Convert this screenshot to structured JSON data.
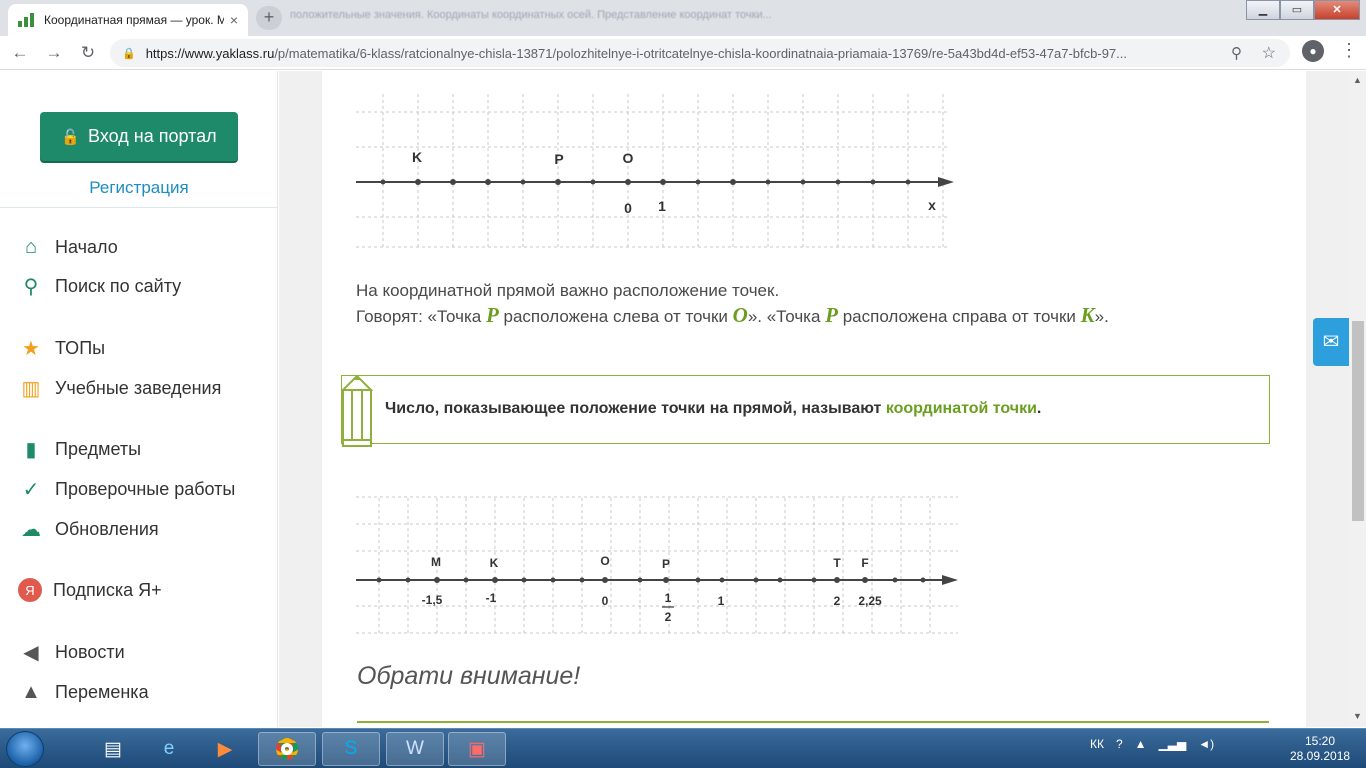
{
  "browser": {
    "tab_title": "Координатная прямая — урок. М",
    "tab_close": "×",
    "new_tab": "+",
    "blurred_tabs": "положительные значения. Координаты координатных осей. Представление координат точки...",
    "url_domain": "https://www.yaklass.ru",
    "url_path": "/p/matematika/6-klass/ratcionalnye-chisla-13871/polozhitelnye-i-otritcatelnye-chisla-koordinatnaia-priamaia-13769/re-5a43bd4d-ef53-47a7-bfcb-97...",
    "back": "←",
    "forward": "→",
    "reload": "↻",
    "zoom_icon": "⚲",
    "bookmark_icon": "☆",
    "menu_icon": "⋮",
    "minimize": "▁",
    "maximize": "▭",
    "close": "✕"
  },
  "sidebar": {
    "login_label": "Вход на портал",
    "register_label": "Регистрация",
    "items": [
      {
        "label": "Начало",
        "icon": "home-icon",
        "glyph": "⌂"
      },
      {
        "label": "Поиск по сайту",
        "icon": "search-icon",
        "glyph": "⚲"
      },
      {
        "label": "ТОПы",
        "icon": "star-icon",
        "glyph": "★"
      },
      {
        "label": "Учебные заведения",
        "icon": "institution-icon",
        "glyph": "▥"
      },
      {
        "label": "Предметы",
        "icon": "book-icon",
        "glyph": "▮"
      },
      {
        "label": "Проверочные работы",
        "icon": "check-circle-icon",
        "glyph": "✓"
      },
      {
        "label": "Обновления",
        "icon": "cloud-update-icon",
        "glyph": "☁"
      },
      {
        "label": "Подписка Я+",
        "icon": "subscription-icon",
        "glyph": "Я"
      },
      {
        "label": "Новости",
        "icon": "megaphone-icon",
        "glyph": "◀"
      },
      {
        "label": "Переменка",
        "icon": "bell-icon",
        "glyph": "▲"
      }
    ],
    "accent": "#1f8a6a"
  },
  "lesson": {
    "line1": {
      "point_labels": [
        "K",
        "P",
        "O"
      ],
      "tick_labels": [
        "0",
        "1"
      ],
      "axis_label": "x"
    },
    "paragraph_line1": "На координатной прямой важно расположение точек.",
    "paragraph_line2": {
      "p1": "Говорят: «Точка ",
      "v1": "P",
      "p2": " расположена слева от точки ",
      "v2": "O",
      "p3": "». «Точка ",
      "v3": "P",
      "p4": " расположена справа от точки ",
      "v4": "K",
      "p5": "»."
    },
    "definition": {
      "text": "Число, показывающее положение точки на прямой, называют ",
      "highlight": "координатой точки",
      "end": "."
    },
    "line2": {
      "point_labels": [
        "M",
        "K",
        "O",
        "P",
        "T",
        "F"
      ],
      "tick_labels": [
        "-1,5",
        "-1",
        "0",
        "1",
        "2",
        "2,25"
      ],
      "fraction_numerator": "1",
      "fraction_denominator": "2"
    },
    "attention_title": "Обрати внимание!",
    "highlight_color": "#6a9e1f"
  },
  "mail_button_icon": "✉",
  "taskbar": {
    "lang": "КК",
    "time": "15:20",
    "date": "28.09.2018"
  }
}
